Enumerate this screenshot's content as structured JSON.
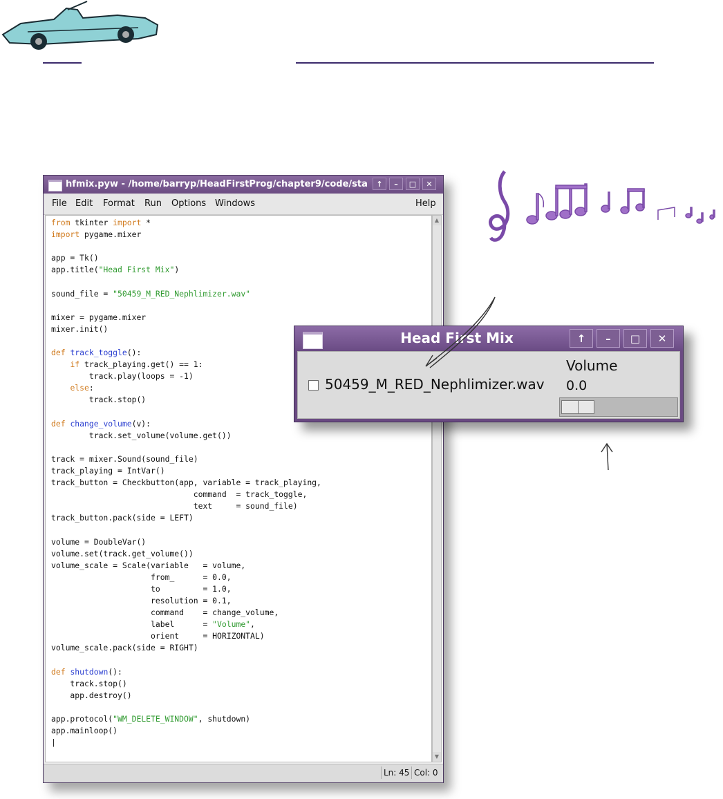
{
  "editor": {
    "title": "hfmix.pyw - /home/barryp/HeadFirstProg/chapter9/code/sta",
    "window_buttons": [
      "↑",
      "–",
      "□",
      "✕"
    ],
    "menu": [
      "File",
      "Edit",
      "Format",
      "Run",
      "Options",
      "Windows",
      "Help"
    ],
    "status": {
      "line": "Ln: 45",
      "col": "Col: 0"
    }
  },
  "mix_window": {
    "title": "Head First Mix",
    "window_buttons": [
      "↑",
      "–",
      "□",
      "✕"
    ],
    "checkbox_label": "50459_M_RED_Nephlimizer.wav",
    "checkbox_checked": false,
    "scale_label": "Volume",
    "scale_value": "0.0",
    "scale_level": 0.0
  },
  "colors": {
    "titlebar": "#6b4c82",
    "keyword": "#d07a1d",
    "function_name": "#2b3fd0",
    "string": "#2f9a2f",
    "rule": "#3b2a6b",
    "notes": "#a070c8"
  },
  "icons": [
    "car-illustration",
    "treble-clef-icon",
    "music-notes-icon",
    "arrow-annotation"
  ]
}
